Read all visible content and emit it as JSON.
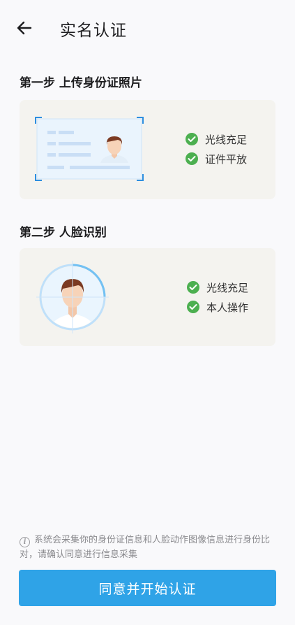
{
  "header": {
    "title": "实名认证"
  },
  "step1": {
    "title": "第一步 上传身份证照片",
    "checks": [
      "光线充足",
      "证件平放"
    ]
  },
  "step2": {
    "title": "第二步 人脸识别",
    "checks": [
      "光线充足",
      "本人操作"
    ]
  },
  "notice": {
    "text": "系统会采集你的身份证信息和人脸动作图像信息进行身份比对，请确认同意进行信息采集"
  },
  "cta": {
    "label": "同意并开始认证"
  },
  "colors": {
    "accent": "#2fa3e7",
    "check": "#4caf50",
    "card_bg": "#f4f3ef"
  }
}
